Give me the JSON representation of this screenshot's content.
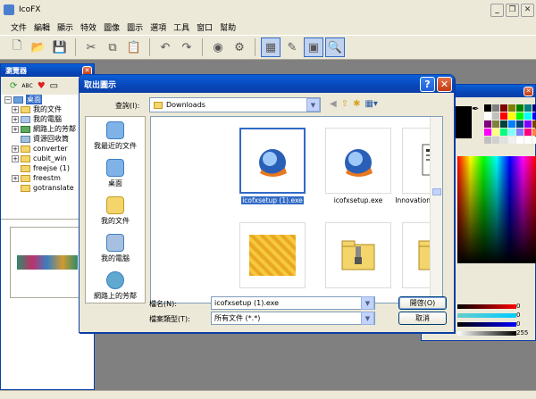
{
  "app": {
    "title": "IcoFX",
    "menu": [
      "文件",
      "編輯",
      "顯示",
      "特效",
      "圖像",
      "圖示",
      "選項",
      "工具",
      "窗口",
      "幫助"
    ]
  },
  "browser": {
    "title": "瀏覽器",
    "tree": [
      {
        "label": "桌面",
        "selected": true
      },
      {
        "label": "我的文件"
      },
      {
        "label": "我的電腦"
      },
      {
        "label": "網路上的芳鄰"
      },
      {
        "label": "資源回收筒"
      },
      {
        "label": "converter"
      },
      {
        "label": "cubit_win"
      },
      {
        "label": "freejse (1)"
      },
      {
        "label": "freestm"
      },
      {
        "label": "gotranslate"
      }
    ]
  },
  "palette": {
    "slider_values": [
      "0",
      "0",
      "0",
      "255"
    ],
    "colors": [
      "#000000",
      "#808080",
      "#800000",
      "#808000",
      "#008000",
      "#008080",
      "#000080",
      "#ffffff",
      "#c0c0c0",
      "#ff0000",
      "#ffff00",
      "#00ff00",
      "#00ffff",
      "#0000ff",
      "#800080",
      "#808040",
      "#004040",
      "#0080ff",
      "#004080",
      "#8000ff",
      "#804000",
      "#ff00ff",
      "#ffff80",
      "#00ff80",
      "#80ffff",
      "#8080ff",
      "#ff0080",
      "#ff8040",
      "#c0c0c0",
      "#d0d0d0",
      "#e0e0e0",
      "#f0f0f0",
      "#ffffff",
      "#ffffff",
      "#ffffff"
    ]
  },
  "dialog": {
    "title": "取出圖示",
    "look_in_label": "查詢(I):",
    "look_in_value": "Downloads",
    "places": [
      "我最近的文件",
      "桌面",
      "我的文件",
      "我的電腦",
      "網路上的芳鄰"
    ],
    "files": [
      {
        "name": "icofxsetup (1).exe",
        "icon": "icofx-setup-icon",
        "selected": true
      },
      {
        "name": "icofxsetup.exe",
        "icon": "icofx-setup-icon"
      },
      {
        "name": "InnovationsfromMSRA...",
        "icon": "document-icon"
      },
      {
        "name": "",
        "icon": "texture-icon"
      },
      {
        "name": "",
        "icon": "zip-folder-icon"
      },
      {
        "name": "",
        "icon": "zip-folder-icon"
      }
    ],
    "filename_label": "檔名(N):",
    "filename_value": "icofxsetup (1).exe",
    "filetype_label": "檔案類型(T):",
    "filetype_value": "所有文件 (*.*)",
    "open_button": "開啓(O)",
    "cancel_button": "取消"
  }
}
